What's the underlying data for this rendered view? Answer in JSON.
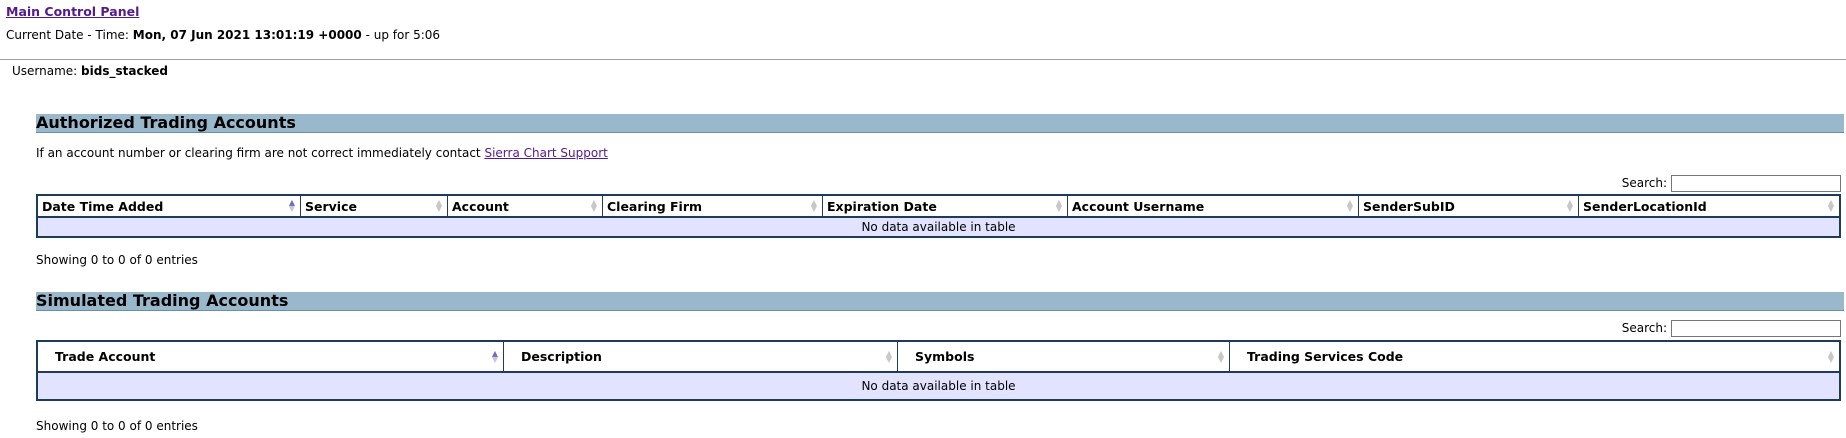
{
  "header": {
    "title_link": "Main Control Panel",
    "datetime_prefix": "Current Date - Time:",
    "datetime_value": "Mon, 07 Jun 2021 13:01:19 +0000",
    "uptime": "- up for 5:06"
  },
  "user": {
    "label": "Username:",
    "value": "bids_stacked"
  },
  "authorized": {
    "heading": "Authorized Trading Accounts",
    "notice": "If an account number or clearing firm are not correct immediately contact",
    "support_link": "Sierra Chart Support",
    "search_label": "Search:",
    "search_value": "",
    "columns": [
      "Date Time Added",
      "Service",
      "Account",
      "Clearing Firm",
      "Expiration Date",
      "Account Username",
      "SenderSubID",
      "SenderLocationId"
    ],
    "empty_message": "No data available in table",
    "info": "Showing 0 to 0 of 0 entries"
  },
  "simulated": {
    "heading": "Simulated Trading Accounts",
    "search_label": "Search:",
    "search_value": "",
    "columns": [
      "Trade Account",
      "Description",
      "Symbols",
      "Trading Services Code"
    ],
    "empty_message": "No data available in table",
    "info": "Showing 0 to 0 of 0 entries"
  },
  "icons": {
    "sort_both": "sort-both-icon",
    "sort_asc": "sort-ascending-icon"
  },
  "colors": {
    "link": "#551a8b",
    "section_header": "#9ab8cc",
    "table_border": "#1f3b57",
    "empty_row_bg": "#e2e4ff"
  }
}
